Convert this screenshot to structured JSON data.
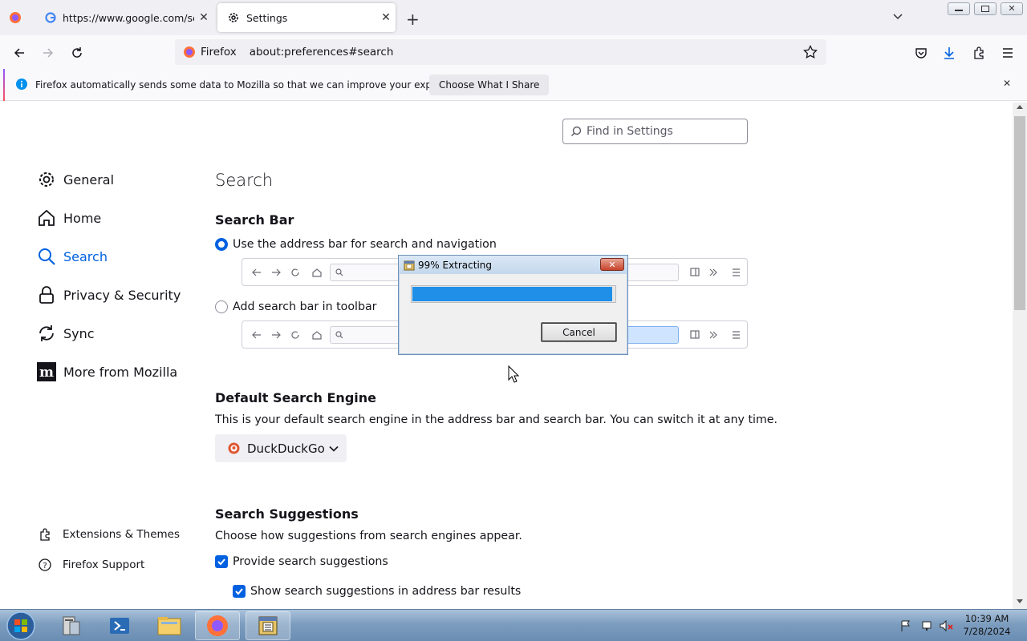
{
  "tabs": [
    {
      "title": "https://www.google.com/search",
      "favicon": "google-icon"
    },
    {
      "title": "Settings",
      "favicon": "gear-icon",
      "active": true
    }
  ],
  "navbar": {
    "identity_label": "Firefox",
    "url": "about:preferences#search"
  },
  "notification": {
    "message": "Firefox automatically sends some data to Mozilla so that we can improve your experience.",
    "button_label": "Choose What I Share"
  },
  "find": {
    "placeholder": "Find in Settings"
  },
  "sidebar": {
    "items": [
      {
        "label": "General",
        "icon": "gear-icon"
      },
      {
        "label": "Home",
        "icon": "home-icon"
      },
      {
        "label": "Search",
        "icon": "search-icon",
        "selected": true
      },
      {
        "label": "Privacy & Security",
        "icon": "lock-icon"
      },
      {
        "label": "Sync",
        "icon": "sync-icon"
      },
      {
        "label": "More from Mozilla",
        "icon": "mozilla-icon"
      }
    ],
    "footer": [
      {
        "label": "Extensions & Themes",
        "icon": "puzzle-icon"
      },
      {
        "label": "Firefox Support",
        "icon": "help-icon"
      }
    ]
  },
  "main": {
    "page_title": "Search",
    "search_bar": {
      "heading": "Search Bar",
      "option_address": "Use the address bar for search and navigation",
      "option_toolbar": "Add search bar in toolbar",
      "selected": "address"
    },
    "default_engine": {
      "heading": "Default Search Engine",
      "description": "This is your default search engine in the address bar and search bar. You can switch it at any time.",
      "selected": "DuckDuckGo"
    },
    "suggestions": {
      "heading": "Search Suggestions",
      "description": "Choose how suggestions from search engines appear.",
      "provide_label": "Provide search suggestions",
      "provide_checked": true,
      "address_bar_label": "Show search suggestions in address bar results",
      "address_bar_checked": true
    }
  },
  "dialog": {
    "title": "99% Extracting",
    "progress": 0.99,
    "cancel_label": "Cancel"
  },
  "taskbar": {
    "time": "10:39 AM",
    "date": "7/28/2024"
  },
  "colors": {
    "accent": "#0061e0",
    "progress": "#1f8fe8",
    "info": "#0090ed"
  }
}
